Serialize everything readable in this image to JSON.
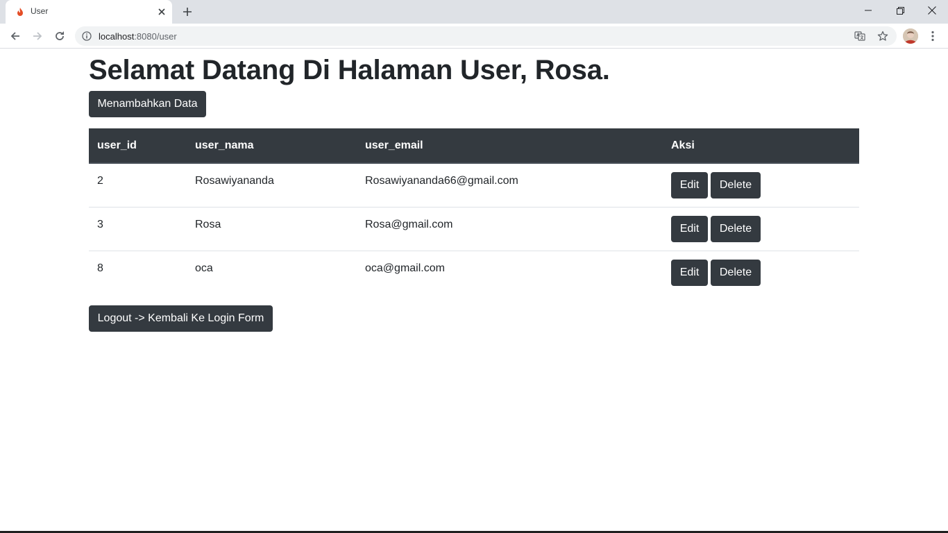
{
  "browser": {
    "tab_title": "User",
    "url_host": "localhost",
    "url_rest": ":8080/user",
    "icons": {
      "favicon": "flame-icon",
      "close_tab": "close-icon",
      "new_tab": "plus-icon",
      "back": "arrow-left-icon",
      "forward": "arrow-right-icon",
      "reload": "reload-icon",
      "site_info": "info-icon",
      "translate": "translate-icon",
      "bookmark": "star-icon",
      "menu": "kebab-menu-icon"
    },
    "favicon_color": "#e44d26"
  },
  "page": {
    "title": "Selamat Datang Di Halaman User, Rosa.",
    "add_button_label": "Menambahkan Data",
    "logout_button_label": "Logout -> Kembali Ke Login Form"
  },
  "table": {
    "headers": [
      "user_id",
      "user_nama",
      "user_email",
      "Aksi"
    ],
    "rows": [
      {
        "user_id": "2",
        "user_nama": "Rosawiyananda",
        "user_email": "Rosawiyananda66@gmail.com"
      },
      {
        "user_id": "3",
        "user_nama": "Rosa",
        "user_email": "Rosa@gmail.com"
      },
      {
        "user_id": "8",
        "user_nama": "oca",
        "user_email": "oca@gmail.com"
      }
    ],
    "edit_label": "Edit",
    "delete_label": "Delete"
  },
  "theme": {
    "dark_button": "#343a40",
    "header_bg": "#343a40",
    "text": "#212529",
    "row_border": "#dee2e6"
  }
}
